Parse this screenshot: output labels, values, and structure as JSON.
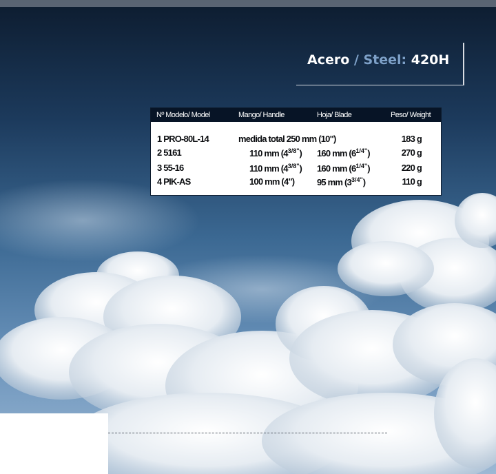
{
  "label": {
    "acero": "Acero",
    "separator": " / ",
    "steel": "Steel:",
    "grade": " 420H"
  },
  "table": {
    "headers": [
      "Nº Modelo/ Model",
      "Mango/ Handle",
      "Hoja/ Blade",
      "Peso/ Weight"
    ],
    "rows": [
      {
        "model": "1  PRO-80L-14",
        "handle": "medida total 250 mm (10\")",
        "blade": "",
        "weight": "183 g"
      },
      {
        "model": "2  5161",
        "handle_main": "110 mm (4",
        "handle_sup": "3/8\"",
        "handle_end": ")",
        "blade_main": "160 mm (6",
        "blade_sup": "1/4\"",
        "blade_end": ")",
        "weight": "270 g"
      },
      {
        "model": "3  55-16",
        "handle_main": "110 mm (4",
        "handle_sup": "3/8\"",
        "handle_end": ")",
        "blade_main": "160 mm (6",
        "blade_sup": "1/4\"",
        "blade_end": ")",
        "weight": "220 g"
      },
      {
        "model": "4  PIK-AS",
        "handle": "100 mm (4\")",
        "blade_main": "95 mm (3",
        "blade_sup": "3/4\"",
        "blade_end": ")",
        "weight": "110 g"
      }
    ]
  },
  "colors": {
    "sky_top": "#0e1f33",
    "sky_mid": "#2b5580",
    "sky_low": "#5a86b3",
    "header_bg": "#071426",
    "accent": "#7ea1c8"
  }
}
